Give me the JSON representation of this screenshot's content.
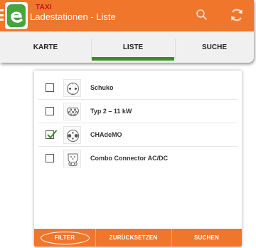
{
  "appbar": {
    "subtitle": "TAXI",
    "title": "Ladestationen - Liste",
    "icons": [
      "drawer-icon",
      "app-logo-e-icon",
      "search-icon",
      "refresh-icon"
    ],
    "color": "#f0762c"
  },
  "tabs": [
    {
      "label": "KARTE",
      "active": false
    },
    {
      "label": "LISTE",
      "active": true
    },
    {
      "label": "SUCHE",
      "active": false
    }
  ],
  "tab_indicator_color": "#3f8a2a",
  "filters": [
    {
      "label": "Schuko",
      "checked": false,
      "icon": "schuko-plug-icon"
    },
    {
      "label": "Typ 2 – 11 kW",
      "checked": false,
      "icon": "type2-plug-icon"
    },
    {
      "label": "CHAdeMO",
      "checked": true,
      "icon": "chademo-plug-icon"
    },
    {
      "label": "Combo Connector AC/DC",
      "checked": false,
      "icon": "combo-plug-icon"
    }
  ],
  "footer": {
    "filter": "FILTER",
    "reset": "ZURÜCKSETZEN",
    "search": "SUCHEN",
    "color": "#f0762c"
  }
}
